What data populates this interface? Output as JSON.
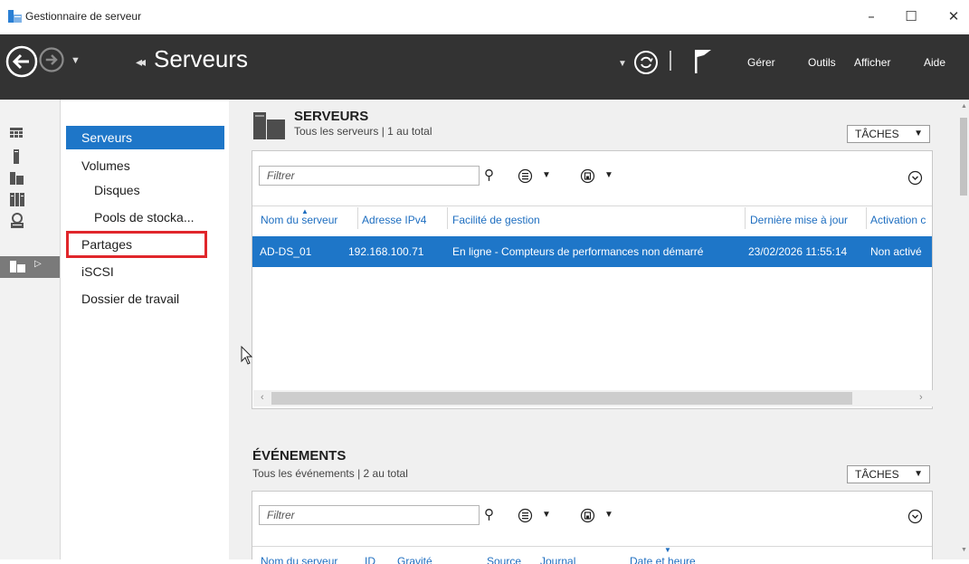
{
  "window": {
    "title": "Gestionnaire de serveur",
    "controls": {
      "minimize": "–",
      "maximize": "☐",
      "close": "✕"
    }
  },
  "header": {
    "breadcrumb_prefix": "◂◂",
    "page_title": "Serveurs",
    "menu": [
      "Gérer",
      "Outils",
      "Afficher",
      "Aide"
    ]
  },
  "icon_strip": {
    "items": [
      "dashboard-icon",
      "local-server-icon",
      "all-servers-icon",
      "ad-ds-icon",
      "dns-icon",
      "file-storage-icon"
    ]
  },
  "nav": {
    "items": [
      {
        "label": "Serveurs"
      },
      {
        "label": "Volumes"
      },
      {
        "label": "Disques"
      },
      {
        "label": "Pools de stocka..."
      },
      {
        "label": "Partages"
      },
      {
        "label": "iSCSI"
      },
      {
        "label": "Dossier de travail"
      }
    ]
  },
  "servers": {
    "title": "SERVEURS",
    "subtitle": "Tous les serveurs | 1 au total",
    "tasks_label": "TÂCHES",
    "filter_placeholder": "Filtrer",
    "columns": [
      "Nom du serveur",
      "Adresse IPv4",
      "Facilité de gestion",
      "Dernière mise à jour",
      "Activation c"
    ],
    "rows": [
      [
        "AD-DS_01",
        "192.168.100.71",
        "En ligne - Compteurs de performances non démarré",
        "23/02/2026 11:55:14",
        "Non activé"
      ]
    ]
  },
  "events": {
    "title": "ÉVÉNEMENTS",
    "subtitle": "Tous les événements | 2 au total",
    "tasks_label": "TÂCHES",
    "filter_placeholder": "Filtrer",
    "columns": [
      "Nom du serveur",
      "ID",
      "Gravité",
      "Source",
      "Journal",
      "Date et heure"
    ]
  },
  "colors": {
    "header_bg": "#333333",
    "selection": "#1e76c8",
    "highlight_box": "#e0262b",
    "link_text": "#1e6ec0"
  }
}
